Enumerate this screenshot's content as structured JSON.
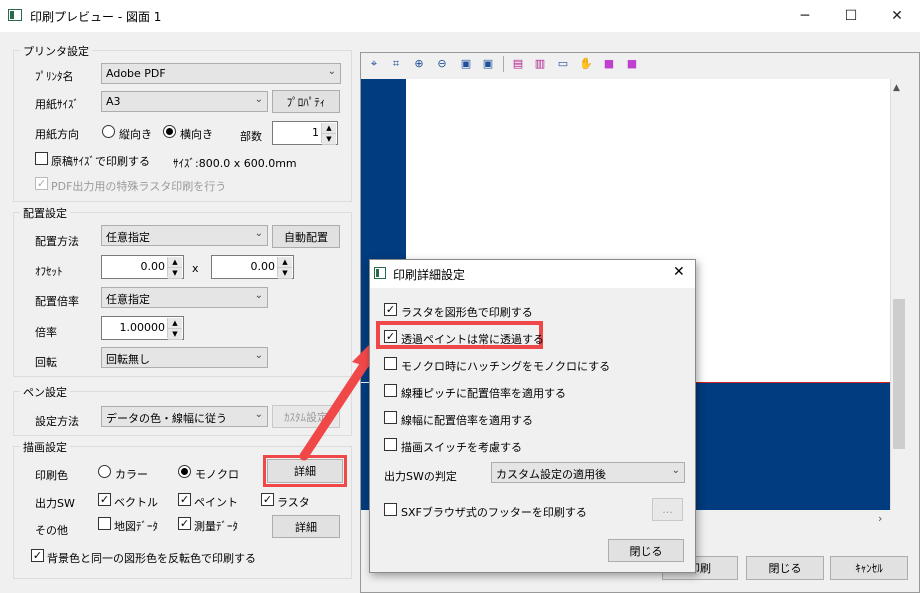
{
  "window": {
    "title": "印刷プレビュー - 図面 1",
    "minimize": "─",
    "maximize": "☐",
    "close": "✕"
  },
  "printer": {
    "legend": "プリンタ設定",
    "name_label": "ﾌﾟﾘﾝﾀ名",
    "name_value": "Adobe PDF",
    "paper_label": "用紙ｻｲｽﾞ",
    "paper_value": "A3",
    "property_button": "ﾌﾟﾛﾊﾟﾃｨ",
    "orientation_label": "用紙方向",
    "portrait": "縦向き",
    "landscape": "横向き",
    "orientation_selected": "landscape",
    "copies_label": "部数",
    "copies_value": "1",
    "original_size_label": "原稿ｻｲｽﾞで印刷する",
    "original_size_checked": false,
    "size_text": "ｻｲｽﾞ:800.0 x 600.0mm",
    "pdf_raster_label": "PDF出力用の特殊ラスタ印刷を行う",
    "pdf_raster_checked": true
  },
  "placement": {
    "legend": "配置設定",
    "method_label": "配置方法",
    "method_value": "任意指定",
    "auto_button": "自動配置",
    "offset_label": "ｵﾌｾｯﾄ",
    "offset_x": "0.00",
    "offset_sep": "x",
    "offset_y": "0.00",
    "scale_method_label": "配置倍率",
    "scale_method_value": "任意指定",
    "scale_label": "倍率",
    "scale_value": "1.00000",
    "rotation_label": "回転",
    "rotation_value": "回転無し"
  },
  "pen": {
    "legend": "ペン設定",
    "method_label": "設定方法",
    "method_value": "データの色・線幅に従う",
    "custom_button": "ｶｽﾀﾑ設定"
  },
  "drawing": {
    "legend": "描画設定",
    "color_label": "印刷色",
    "color": "カラー",
    "mono": "モノクロ",
    "color_selected": "mono",
    "detail_button": "詳細",
    "output_label": "出力SW",
    "vector": "ベクトル",
    "paint": "ペイント",
    "raster": "ラスタ",
    "other_label": "その他",
    "map_data": "地図ﾃﾞｰﾀ",
    "survey_data": "測量ﾃﾞｰﾀ",
    "detail_button2": "詳細",
    "reverse_label": "背景色と同一の図形色を反転色で印刷する"
  },
  "bottom_buttons": {
    "print": "印刷",
    "close": "閉じる",
    "cancel": "ｷｬﾝｾﾙ"
  },
  "dialog": {
    "title": "印刷詳細設定",
    "options": [
      {
        "label": "ラスタを図形色で印刷する",
        "checked": true
      },
      {
        "label": "透過ペイントは常に透過する",
        "checked": true
      },
      {
        "label": "モノクロ時にハッチングをモノクロにする",
        "checked": false
      },
      {
        "label": "線種ピッチに配置倍率を適用する",
        "checked": false
      },
      {
        "label": "線幅に配置倍率を適用する",
        "checked": false
      },
      {
        "label": "描画スイッチを考慮する",
        "checked": false
      }
    ],
    "output_sw_label": "出力SWの判定",
    "output_sw_value": "カスタム設定の適用後",
    "sxf_label": "SXFブラウザ式のフッターを印刷する",
    "sxf_checked": false,
    "browse_button": "...",
    "close_button": "閉じる"
  },
  "colors": {
    "preview_blue": "#003c7f",
    "highlight": "#f04848",
    "red_line": "#cc2222"
  }
}
